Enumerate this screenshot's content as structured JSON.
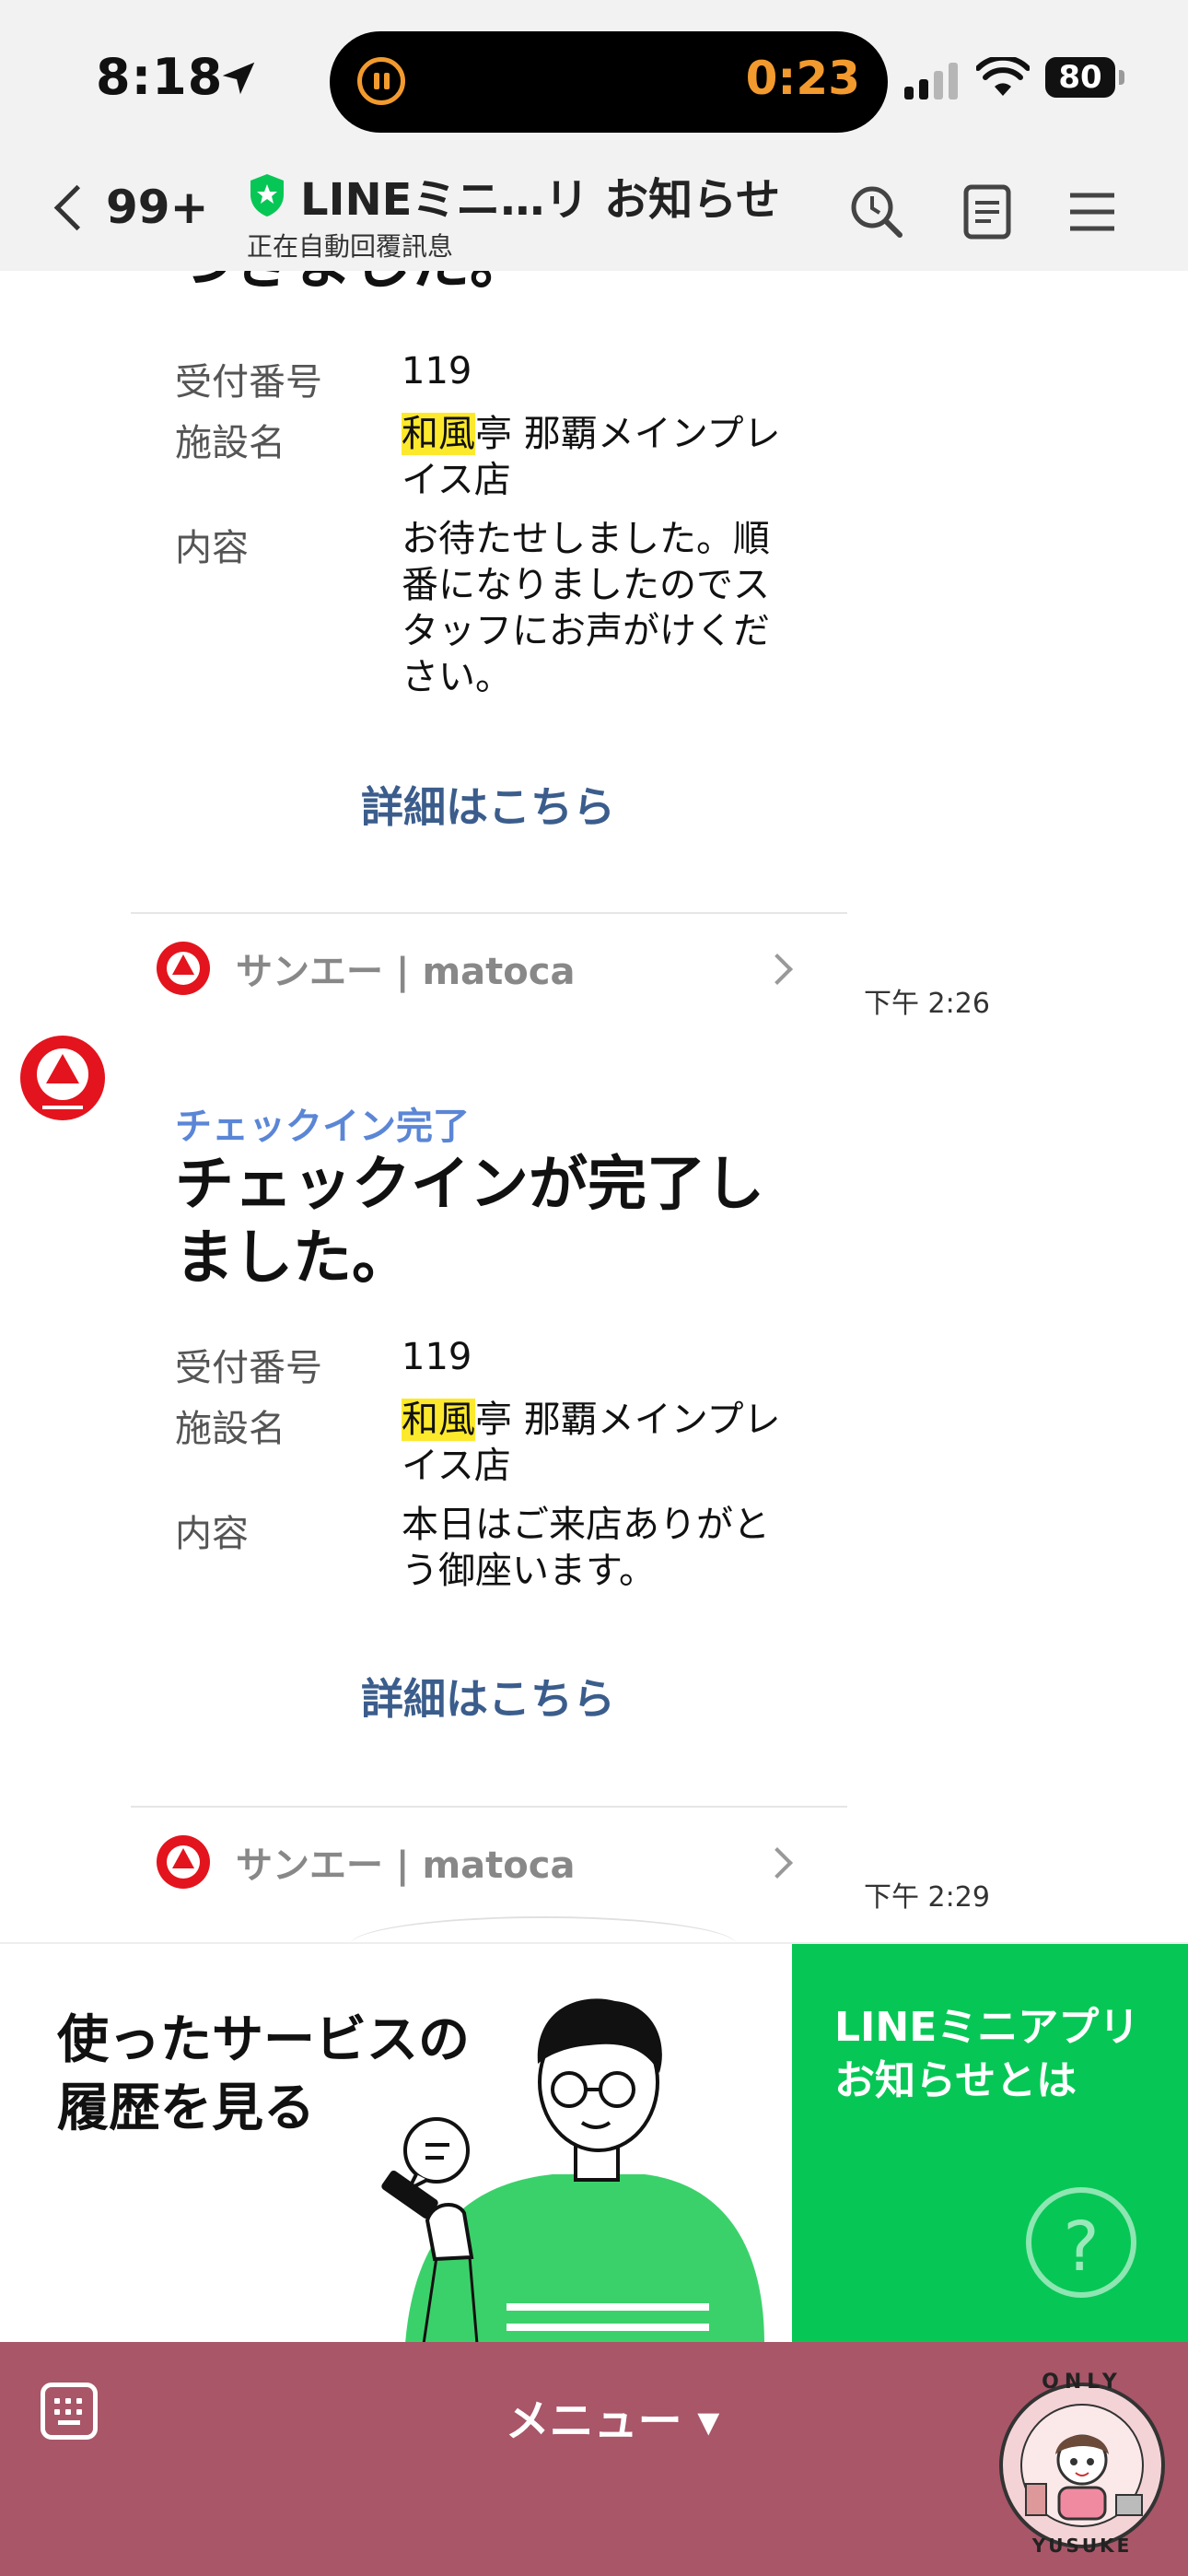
{
  "status": {
    "time": "8:18",
    "timer": "0:23",
    "battery": "80"
  },
  "header": {
    "back_count": "99+",
    "title": "LINEミニ…リ お知らせ",
    "subtitle": "正在自動回覆訊息"
  },
  "messages": [
    {
      "heading_cut": "つきました。",
      "rows": [
        {
          "label": "受付番号",
          "value": "119"
        },
        {
          "label": "施設名",
          "value_highlight": "和風",
          "value_rest": "亭 那覇メインプレイス店"
        },
        {
          "label": "内容",
          "value": "お待たせしました。順番になりましたのでスタッフにお声がけください。"
        }
      ],
      "link": "詳細はこちら"
    },
    {
      "source": "サンエー | matoca",
      "time": "下午 2:26",
      "tag": "チェックイン完了",
      "heading": "チェックインが完了しました。",
      "rows": [
        {
          "label": "受付番号",
          "value": "119"
        },
        {
          "label": "施設名",
          "value_highlight": "和風",
          "value_rest": "亭 那覇メインプレイス店"
        },
        {
          "label": "内容",
          "value": "本日はご来店ありがとう御座います。"
        }
      ],
      "link": "詳細はこちら"
    },
    {
      "source": "サンエー | matoca",
      "time": "下午 2:29"
    }
  ],
  "banner": {
    "left_text": "使ったサービスの履歴を見る",
    "right_text": "LINEミニアプリお知らせとは",
    "help_glyph": "?"
  },
  "bottom": {
    "menu_label": "メニュー ▾"
  },
  "sticker": {
    "text_top": "ONLY",
    "text_bottom": "YUSUKE"
  },
  "colors": {
    "line_green": "#06c755",
    "tag_blue": "#5b86d6",
    "link_blue": "#3b5d8c",
    "highlight": "#fde92c",
    "menu_bar": "#a85668",
    "brand_red": "#e3141d"
  },
  "icons": [
    "location-arrow-icon",
    "pause-icon",
    "signal-icon",
    "wifi-icon",
    "battery-icon",
    "back-chevron-icon",
    "shield-icon",
    "search-icon",
    "notes-icon",
    "hamburger-menu-icon",
    "chevron-right-icon",
    "keyboard-icon",
    "help-icon"
  ]
}
